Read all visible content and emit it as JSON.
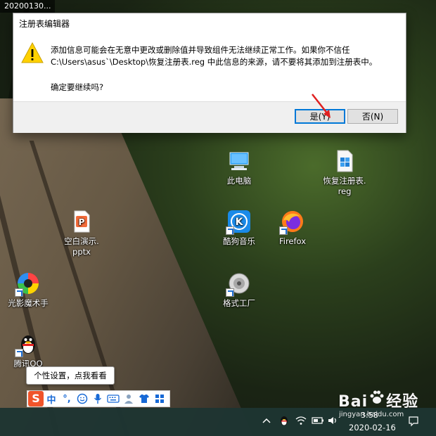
{
  "desktop": {
    "top_label": "20200130..."
  },
  "dialog": {
    "title": "注册表编辑器",
    "message_line1": "添加信息可能会在无意中更改或删除值并导致组件无法继续正常工作。如果你不信任",
    "message_line2": "C:\\Users\\asus`\\Desktop\\恢复注册表.reg 中此信息的来源，请不要将其添加到注册表中。",
    "question": "确定要继续吗?",
    "yes_label": "是(Y)",
    "no_label": "否(N)",
    "icon": "warning-icon"
  },
  "icons": {
    "this_pc": "此电脑",
    "reg_file": "恢复注册表.\nreg",
    "pptx": "空白演示.\npptx",
    "kugou": "酷狗音乐",
    "firefox": "Firefox",
    "light_shadow": "光影魔术手",
    "factory": "格式工厂",
    "qq": "腾讯QQ"
  },
  "tooltip": {
    "text": "个性设置，点我看看"
  },
  "ime": {
    "logo": "S",
    "mode": "中",
    "punct": "°,",
    "items": [
      "emoji-icon",
      "mic-icon",
      "keyboard-icon",
      "user-icon",
      "skin-icon",
      "grid-icon"
    ]
  },
  "taskbar": {
    "time": "3:58",
    "date": "2020-02-16"
  },
  "watermark": {
    "brand_left": "Bai",
    "brand_right": "经验",
    "url": "jingyan.baidu.com"
  },
  "colors": {
    "accent": "#0078d7",
    "warning": "#ffd100",
    "ime_brand": "#f0542a"
  }
}
